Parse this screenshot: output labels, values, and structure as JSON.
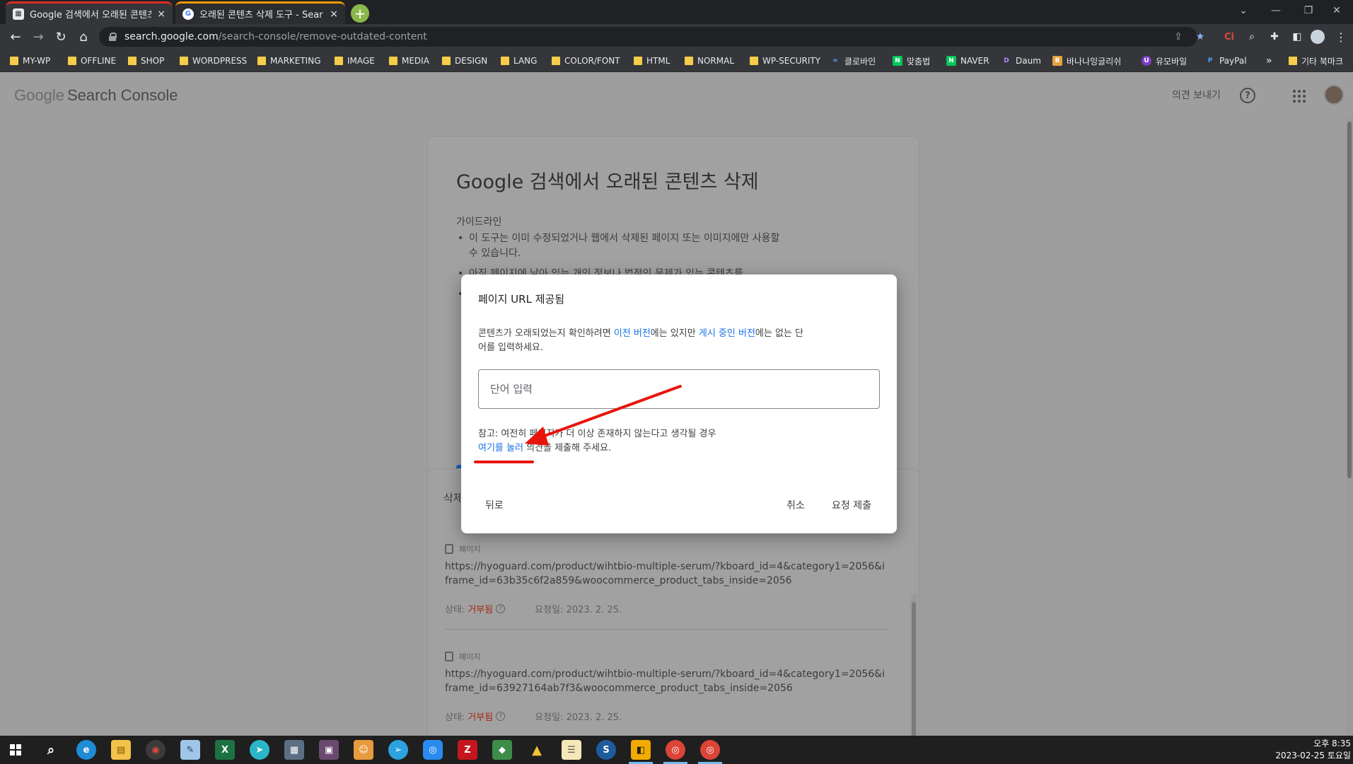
{
  "browser": {
    "tabs": [
      {
        "title": "Google 검색에서 오래된 콘텐츠",
        "close": "×"
      },
      {
        "title": "오래된 콘텐츠 삭제 도구 - Sear",
        "close": "×"
      }
    ],
    "new_tab": "+",
    "url_host": "search.google.com",
    "url_path": "/search-console/remove-outdated-content",
    "bookmarks": [
      "MY-WP",
      "OFFLINE",
      "SHOP",
      "WORDPRESS",
      "MARKETING",
      "IMAGE",
      "MEDIA",
      "DESIGN",
      "LANG",
      "COLOR/FONT",
      "HTML",
      "NORMAL",
      "WP-SECURITY",
      "클로바인",
      "맞춤법",
      "NAVER",
      "Daum",
      "바나나잉글리쉬",
      "유모바일",
      "PayPal"
    ],
    "bookmarks_more": "»",
    "other_bookmarks": "기타 북마크",
    "ext_label": "Ci"
  },
  "header": {
    "logo": "Google",
    "product": "Search Console",
    "feedback": "의견 보내기",
    "help": "?"
  },
  "main": {
    "title": "Google 검색에서 오래된 콘텐츠 삭제",
    "guideline_heading": "가이드라인",
    "guidelines": [
      "이 도구는 이미 수정되었거나 웹에서 삭제된 페이지 또는 이미지에만 사용할 수 있습니다.",
      "아직 페이지에 남아 있는 개인 정보나 법적인 문제가 있는 콘텐츠를",
      ""
    ]
  },
  "requests": {
    "section_title": "삭제",
    "items": [
      {
        "kind": "페이지",
        "url": "https://hyoguard.com/product/wihtbio-multiple-serum/?kboard_id=4&category1=2056&iframe_id=63b35c6f2a859&woocommerce_product_tabs_inside=2056",
        "status_label": "상태:",
        "status": "거부됨",
        "requested": "요청일: 2023. 2. 25."
      },
      {
        "kind": "페이지",
        "url": "https://hyoguard.com/product/wihtbio-multiple-serum/?kboard_id=4&category1=2056&iframe_id=63927164ab7f3&woocommerce_product_tabs_inside=2056",
        "status_label": "상태:",
        "status": "거부됨",
        "requested": "요청일: 2023. 2. 25."
      }
    ]
  },
  "dialog": {
    "title": "페이지 URL 제공됨",
    "body_pre": "콘텐츠가 오래되었는지 확인하려면 ",
    "link1": "이전 버전",
    "body_mid": "에는 있지만 ",
    "link2": "게시 중인 버전",
    "body_post": "에는 없는 단어를 입력하세요.",
    "input_placeholder": "단어 입력",
    "note_pre": "참고: 여전히 페이지가 더 이상 존재하지 않는다고 생각될 경우",
    "note_link": "여기를 눌러",
    "note_post": " 의견을 제출해 주세요.",
    "back": "뒤로",
    "cancel": "취소",
    "submit": "요청 제출"
  },
  "taskbar": {
    "time": "오후 8:35",
    "date": "2023-02-25 토요일"
  },
  "colors": {
    "accent_blue": "#1a73e8",
    "annotation_red": "#e8140c",
    "rejected_red": "#a52714",
    "tab_active_border": "#d93025"
  }
}
